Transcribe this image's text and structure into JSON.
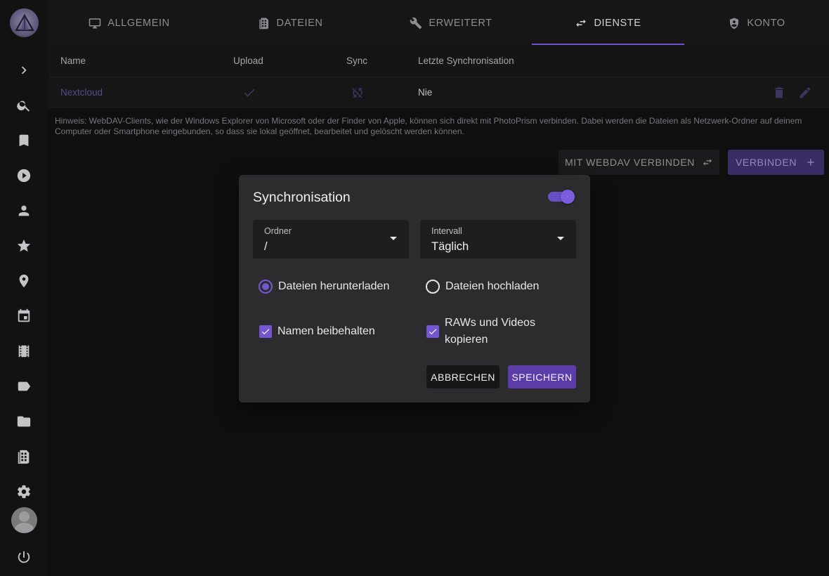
{
  "tabs": [
    {
      "label": "ALLGEMEIN",
      "icon": "monitor-icon"
    },
    {
      "label": "DATEIEN",
      "icon": "file-cabinet-icon"
    },
    {
      "label": "ERWEITERT",
      "icon": "wrench-icon"
    },
    {
      "label": "DIENSTE",
      "icon": "swap-arrows-icon",
      "active": true
    },
    {
      "label": "KONTO",
      "icon": "user-shield-icon"
    }
  ],
  "sidebar": {
    "items": [
      {
        "icon": "chevron-right-icon"
      },
      {
        "icon": "search-icon"
      },
      {
        "icon": "bookmark-icon"
      },
      {
        "icon": "play-circle-icon"
      },
      {
        "icon": "person-icon"
      },
      {
        "icon": "star-icon"
      },
      {
        "icon": "location-pin-icon"
      },
      {
        "icon": "calendar-icon"
      },
      {
        "icon": "film-icon"
      },
      {
        "icon": "label-icon"
      },
      {
        "icon": "folder-icon"
      },
      {
        "icon": "file-cabinet-icon"
      },
      {
        "icon": "gear-icon"
      },
      {
        "icon": "power-icon"
      }
    ]
  },
  "table": {
    "headers": [
      "Name",
      "Upload",
      "Sync",
      "Letzte Synchronisation"
    ],
    "rows": [
      {
        "name": "Nextcloud",
        "upload_icon": "check-icon",
        "sync_icon": "sync-disabled-icon",
        "last_sync": "Nie"
      }
    ]
  },
  "hint": "Hinweis: WebDAV-Clients, wie der Windows Explorer von Microsoft oder der Finder von Apple, können sich direkt mit PhotoPrism verbinden. Dabei werden die Dateien als Netzwerk-Ordner auf deinem Computer oder Smartphone eingebunden, so dass sie lokal geöffnet, bearbeitet und gelöscht werden können.",
  "actions": {
    "webdav_label": "MIT WEBDAV VERBINDEN",
    "connect_label": "VERBINDEN"
  },
  "dialog": {
    "title": "Synchronisation",
    "enabled": true,
    "folder": {
      "label": "Ordner",
      "value": "/"
    },
    "interval": {
      "label": "Intervall",
      "value": "Täglich"
    },
    "download_label": "Dateien herunterladen",
    "upload_label": "Dateien hochladen",
    "download_selected": true,
    "keep_names_label": "Namen beibehalten",
    "keep_names_checked": true,
    "raw_videos_line1": "RAWs und Videos",
    "raw_videos_line2": "kopieren",
    "raw_videos_checked": true,
    "cancel_label": "ABBRECHEN",
    "save_label": "SPEICHERN"
  },
  "colors": {
    "accent": "#7557d3",
    "save_button": "#5b3ca8",
    "connect_button": "#3a2d63"
  }
}
